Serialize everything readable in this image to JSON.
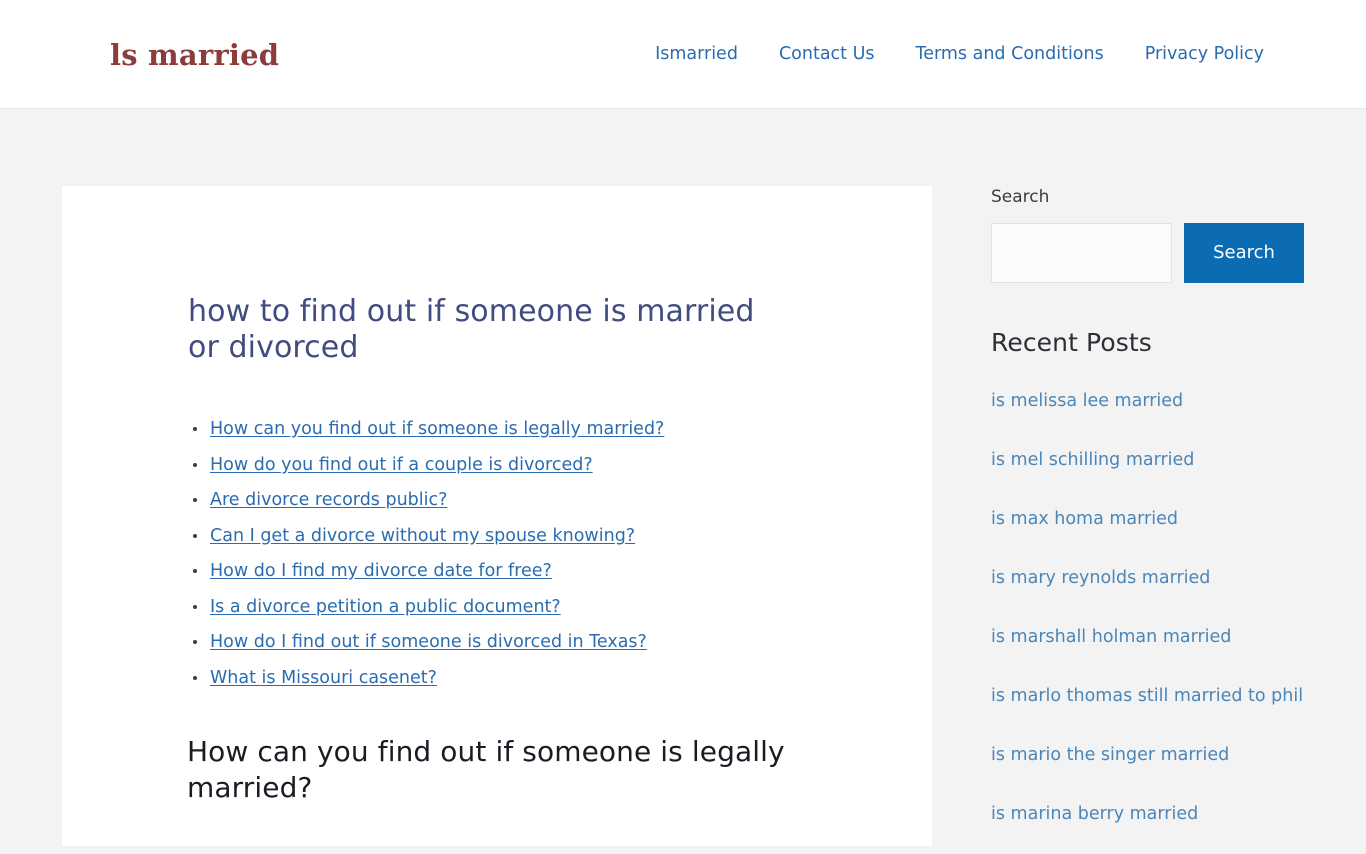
{
  "header": {
    "logo_text": "ls married",
    "nav": [
      {
        "label": "Ismarried"
      },
      {
        "label": "Contact Us"
      },
      {
        "label": "Terms and Conditions"
      },
      {
        "label": "Privacy Policy"
      }
    ]
  },
  "main": {
    "title": "how to find out if someone is married or divorced",
    "toc": [
      {
        "label": "How can you find out if someone is legally married?"
      },
      {
        "label": "How do you find out if a couple is divorced?"
      },
      {
        "label": "Are divorce records public?"
      },
      {
        "label": "Can I get a divorce without my spouse knowing?"
      },
      {
        "label": "How do I find my divorce date for free?"
      },
      {
        "label": "Is a divorce petition a public document?"
      },
      {
        "label": "How do I find out if someone is divorced in Texas?"
      },
      {
        "label": "What is Missouri casenet?"
      }
    ],
    "section_heading": "How can you find out if someone is legally married?"
  },
  "sidebar": {
    "search": {
      "label": "Search",
      "value": "",
      "placeholder": "",
      "button_label": "Search"
    },
    "recent_posts": {
      "title": "Recent Posts",
      "items": [
        {
          "label": "is melissa lee married"
        },
        {
          "label": "is mel schilling married"
        },
        {
          "label": "is max homa married"
        },
        {
          "label": "is mary reynolds married"
        },
        {
          "label": "is marshall holman married"
        },
        {
          "label": "is marlo thomas still married to phil"
        },
        {
          "label": "is mario the singer married"
        },
        {
          "label": "is marina berry married"
        }
      ]
    }
  },
  "colors": {
    "page_background": "#f3f3f4",
    "logo": "#8e3b3b",
    "link_blue": "#2b6cb0",
    "title_navy": "#414c80",
    "button_blue": "#0b6cb4",
    "recent_link": "#4a86b8"
  }
}
